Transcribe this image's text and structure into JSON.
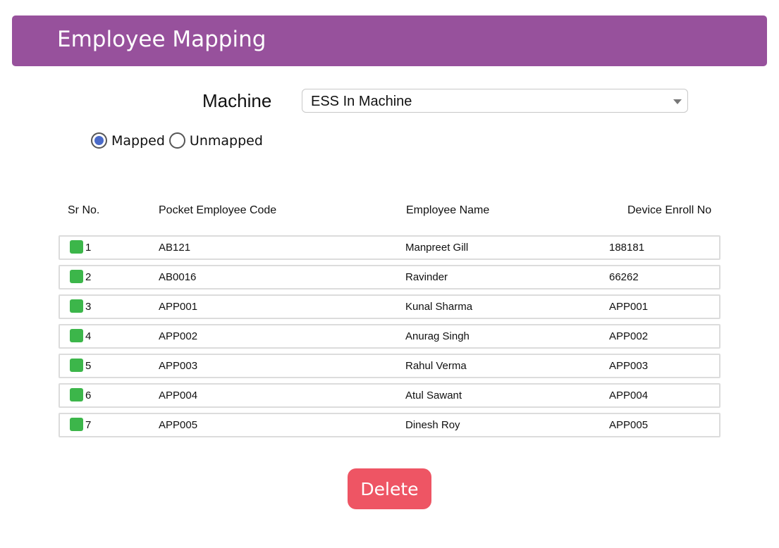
{
  "header": {
    "title": "Employee Mapping",
    "color": "#97519c"
  },
  "machine": {
    "label": "Machine",
    "selected": "ESS In Machine",
    "icon": "chevron-down-icon"
  },
  "filter": {
    "options": [
      {
        "label": "Mapped",
        "selected": true
      },
      {
        "label": "Unmapped",
        "selected": false
      }
    ]
  },
  "table": {
    "columns": [
      "Sr No.",
      "Pocket Employee Code",
      "Employee Name",
      "Device Enroll No"
    ],
    "rows": [
      {
        "sr": "1",
        "code": "AB121",
        "name": "Manpreet Gill",
        "enroll": "188181",
        "checked": true
      },
      {
        "sr": "2",
        "code": "AB0016",
        "name": "Ravinder",
        "enroll": "66262",
        "checked": true
      },
      {
        "sr": "3",
        "code": "APP001",
        "name": "Kunal Sharma",
        "enroll": "APP001",
        "checked": true
      },
      {
        "sr": "4",
        "code": "APP002",
        "name": "Anurag Singh",
        "enroll": "APP002",
        "checked": true
      },
      {
        "sr": "5",
        "code": "APP003",
        "name": "Rahul Verma",
        "enroll": "APP003",
        "checked": true
      },
      {
        "sr": "6",
        "code": "APP004",
        "name": "Atul Sawant",
        "enroll": "APP004",
        "checked": true
      },
      {
        "sr": "7",
        "code": "APP005",
        "name": "Dinesh Roy",
        "enroll": "APP005",
        "checked": true
      }
    ],
    "check_color": "#3cb64a"
  },
  "actions": {
    "delete_label": "Delete",
    "delete_color": "#ee5564"
  }
}
